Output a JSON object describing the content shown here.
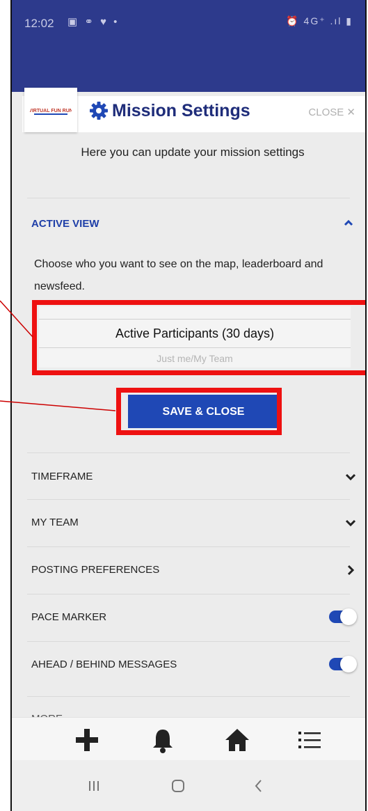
{
  "status_bar": {
    "time": "12:02",
    "left_icons": "▣ ⚭ ♥ •",
    "right_icons": "⏰ 4G⁺ .ıl ▮"
  },
  "header": {
    "logo_text": "VIRTUAL FUN RUN",
    "title": "Mission Settings",
    "close_label": "CLOSE"
  },
  "intro_text": "Here you can update your mission settings",
  "active_view": {
    "title": "ACTIVE VIEW",
    "description": "Choose who you want to see on the map, leaderboard and newsfeed.",
    "selected_option": "Active Participants (30 days)",
    "next_option": "Just me/My Team",
    "save_label": "SAVE & CLOSE"
  },
  "settings_rows": {
    "timeframe": "TIMEFRAME",
    "my_team": "MY TEAM",
    "posting_preferences": "POSTING PREFERENCES",
    "pace_marker": "PACE MARKER",
    "ahead_behind": "AHEAD / BEHIND MESSAGES",
    "more": "MORE"
  },
  "toggles": {
    "pace_marker_on": true,
    "ahead_behind_on": true
  },
  "colors": {
    "accent": "#1f48b5",
    "status_bar": "#2d3a8c",
    "highlight": "#ee1111"
  },
  "bottom_nav_icons": [
    "plus-icon",
    "bell-icon",
    "home-icon",
    "list-icon"
  ],
  "system_nav_icons": [
    "recents-icon",
    "home-circle-icon",
    "back-icon"
  ]
}
